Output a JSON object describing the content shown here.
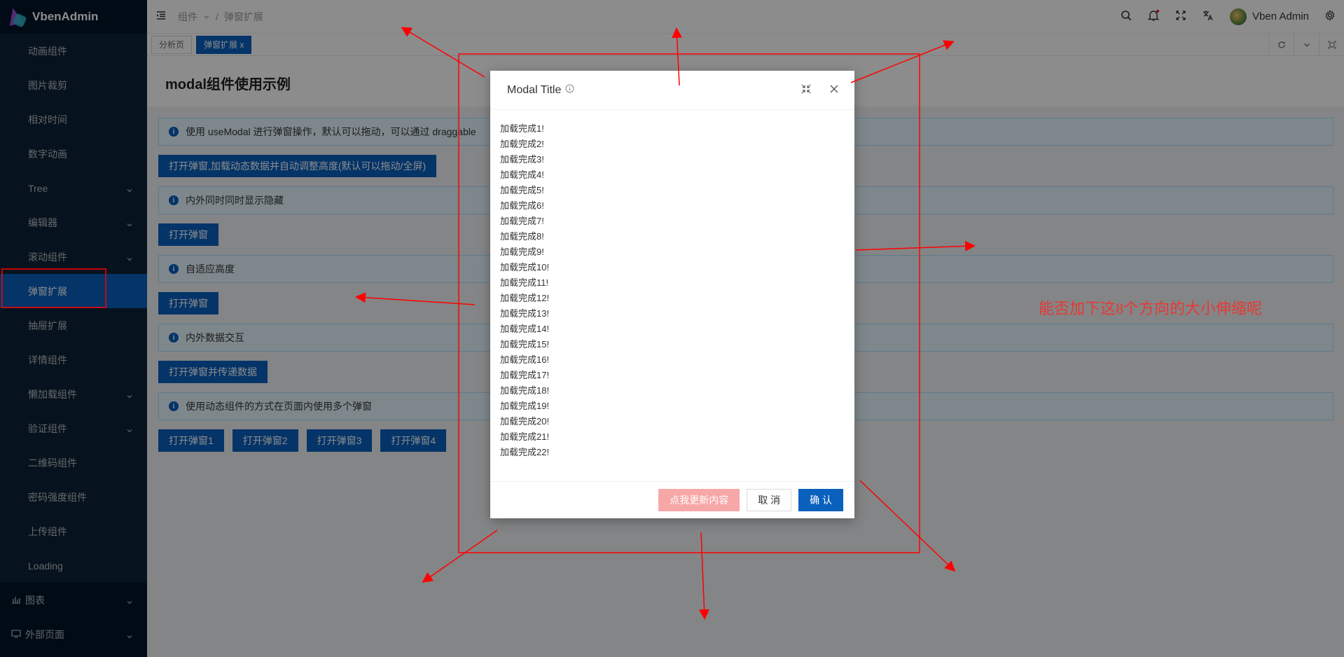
{
  "app": {
    "name": "VbenAdmin"
  },
  "sidebar": {
    "items": [
      {
        "label": "动画组件",
        "chevron": false
      },
      {
        "label": "图片裁剪",
        "chevron": false
      },
      {
        "label": "相对时间",
        "chevron": false
      },
      {
        "label": "数字动画",
        "chevron": false
      },
      {
        "label": "Tree",
        "chevron": true
      },
      {
        "label": "编辑器",
        "chevron": true
      },
      {
        "label": "滚动组件",
        "chevron": true
      },
      {
        "label": "弹窗扩展",
        "chevron": false,
        "active": true
      },
      {
        "label": "抽屉扩展",
        "chevron": false
      },
      {
        "label": "详情组件",
        "chevron": false
      },
      {
        "label": "懒加载组件",
        "chevron": true
      },
      {
        "label": "验证组件",
        "chevron": true
      },
      {
        "label": "二维码组件",
        "chevron": false
      },
      {
        "label": "密码强度组件",
        "chevron": false
      },
      {
        "label": "上传组件",
        "chevron": false
      },
      {
        "label": "Loading",
        "chevron": false
      }
    ],
    "top_items": [
      {
        "label": "图表",
        "icon": "chart-icon"
      },
      {
        "label": "外部页面",
        "icon": "monitor-icon"
      }
    ]
  },
  "header": {
    "breadcrumb": [
      "组件",
      "弹窗扩展"
    ],
    "separator": "/",
    "user_name": "Vben Admin"
  },
  "tabs": [
    {
      "label": "分析页",
      "active": false
    },
    {
      "label": "弹窗扩展",
      "active": true,
      "close": "x"
    }
  ],
  "page": {
    "title": "modal组件使用示例",
    "alerts": [
      "使用 useModal 进行弹窗操作，默认可以拖动，可以通过 draggable",
      "内外同时同时显示隐藏",
      "自适应高度",
      "内外数据交互",
      "使用动态组件的方式在页面内使用多个弹窗"
    ],
    "buttons": {
      "row1": "打开弹窗,加载动态数据并自动调整高度(默认可以拖动/全屏)",
      "row2": "打开弹窗",
      "row3": "打开弹窗",
      "row4": "打开弹窗并传递数据",
      "row5": [
        "打开弹窗1",
        "打开弹窗2",
        "打开弹窗3",
        "打开弹窗4"
      ]
    }
  },
  "modal": {
    "title": "Modal Title",
    "lines": [
      "加载完成1!",
      "加载完成2!",
      "加载完成3!",
      "加载完成4!",
      "加载完成5!",
      "加载完成6!",
      "加载完成7!",
      "加载完成8!",
      "加载完成9!",
      "加载完成10!",
      "加载完成11!",
      "加载完成12!",
      "加载完成13!",
      "加载完成14!",
      "加载完成15!",
      "加载完成16!",
      "加载完成17!",
      "加载完成18!",
      "加载完成19!",
      "加载完成20!",
      "加载完成21!",
      "加载完成22!"
    ],
    "footer": {
      "update_label": "点我更新内容",
      "cancel_label": "取 消",
      "ok_label": "确 认"
    }
  },
  "annotation": {
    "text": "能否加下这8个方向的大小伸缩呢",
    "color": "#e53935"
  }
}
